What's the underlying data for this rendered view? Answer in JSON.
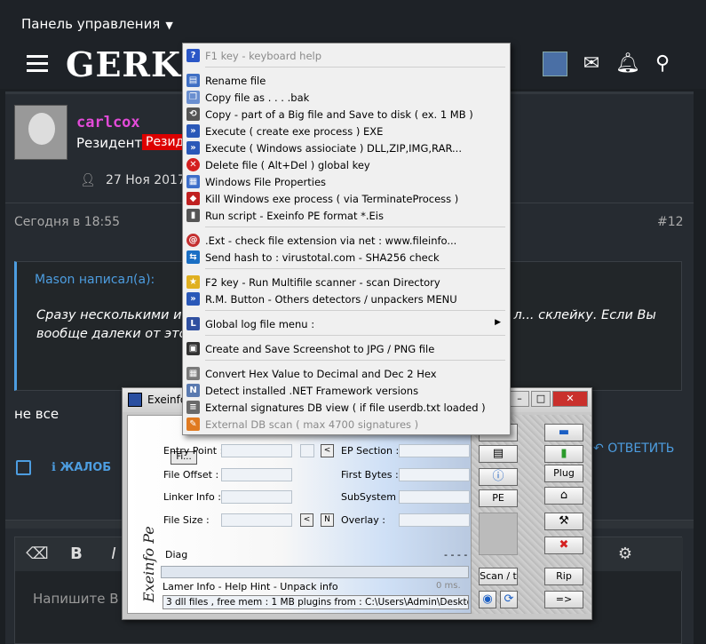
{
  "forum": {
    "control_panel": "Панель управления",
    "logo": "GERKI.R",
    "username": "carlcox",
    "role": "Резидент",
    "badge": "Резид",
    "joined": "27 Ноя 2017",
    "post_date": "Сегодня в 18:55",
    "post_number": "#12",
    "quote_author": "Mason написал(а):",
    "quote_text": "Сразу несколькими ин... была мысль запостить всё это дело, но есть л... склейку. Если Вы вообще далеки от это... песочьте в чем сомнения есть, там ви...",
    "reply_text": "не все",
    "complain": "ЖАЛОБ",
    "reply_button": "ОТВЕТИТЬ",
    "editor_placeholder": "Напишите В",
    "editor_tools": [
      "⌫",
      "B",
      "I",
      "⚙"
    ]
  },
  "exeinfo": {
    "title": "Exeinfo",
    "side_label": "Exeinfo Pe",
    "file_button": "Fi...",
    "fields": {
      "entry_point": "Entry Point :",
      "ep_section": "EP Section :",
      "file_offset": "File Offset :",
      "first_bytes": "First Bytes :",
      "linker_info": "Linker Info :",
      "subsystem": "SubSystem :",
      "file_size": "File Size :",
      "overlay": "Overlay :",
      "diag": "Diag"
    },
    "small_lt": "<",
    "small_n": "N",
    "dashes": "- - - -",
    "hint": "Lamer Info - Help Hint - Unpack info",
    "ms": "0 ms.",
    "status": "3 dll files , free mem : 1 MB  plugins from : C:\\Users\\Admin\\Desktop\\Ск...",
    "buttons": {
      "plug": "Plug",
      "pe": "PE",
      "scan": "Scan / t",
      "rip": "Rip",
      "next": "=>"
    }
  },
  "menu": {
    "items": [
      {
        "label": "F1 key - keyboard help",
        "icon": "help-icon",
        "color": "#2b57c7",
        "glyph": "?",
        "disabled": true
      },
      {
        "label": "Rename file",
        "icon": "rename-icon",
        "color": "#3f6fc4",
        "glyph": "▤"
      },
      {
        "label": "Copy file as   . . . .bak",
        "icon": "copy-icon",
        "color": "#6a8fd0",
        "glyph": "❐"
      },
      {
        "label": "Copy - part of a Big file and Save  to disk ( ex. 1 MB )",
        "icon": "copy-part-icon",
        "color": "#555555",
        "glyph": "⟲"
      },
      {
        "label": "Execute ( create exe process ) EXE",
        "icon": "execute-icon",
        "color": "#2a58b8",
        "glyph": "»"
      },
      {
        "label": "Execute ( Windows assiociate ) DLL,ZIP,IMG,RAR...",
        "icon": "execute-assoc-icon",
        "color": "#2a58b8",
        "glyph": "»"
      },
      {
        "label": "Delete file ( Alt+Del  ) global key",
        "icon": "delete-icon",
        "color": "#d42020",
        "glyph": "✕"
      },
      {
        "label": "Windows File Properties",
        "icon": "properties-icon",
        "color": "#3d6ec9",
        "glyph": "▦"
      },
      {
        "label": "Kill Windows exe process ( via TerminateProcess )",
        "icon": "kill-icon",
        "color": "#c02020",
        "glyph": "◆"
      },
      {
        "label": "Run script - Exeinfo PE  format *.Eis",
        "icon": "script-icon",
        "color": "#555555",
        "glyph": "▮"
      },
      {
        "label": ".Ext - check file extension via net : www.fileinfo...",
        "icon": "ext-icon",
        "color": "#c43030",
        "glyph": "@"
      },
      {
        "label": "Send hash to : virustotal.com - SHA256 check",
        "icon": "virustotal-icon",
        "color": "#1a6fc4",
        "glyph": "⇆"
      },
      {
        "label": "F2 key - Run Multifile scanner  - scan Directory",
        "icon": "scanner-icon",
        "color": "#e0b020",
        "glyph": "★"
      },
      {
        "label": "R.M. Button - Others detectors / unpackers  MENU",
        "icon": "detectors-icon",
        "color": "#2a58b8",
        "glyph": "»"
      },
      {
        "label": "Global log file menu :",
        "icon": "log-icon",
        "color": "#3050a0",
        "glyph": "L",
        "submenu": true
      },
      {
        "label": "Create and Save Screenshot to JPG / PNG  file",
        "icon": "screenshot-icon",
        "color": "#333333",
        "glyph": "▣"
      },
      {
        "label": "Convert Hex Value to Decimal and Dec 2 Hex",
        "icon": "convert-icon",
        "color": "#7a7a7a",
        "glyph": "▦"
      },
      {
        "label": "Detect installed .NET Framework versions",
        "icon": "dotnet-icon",
        "color": "#5a7ab0",
        "glyph": "N"
      },
      {
        "label": "External signatures DB view  (  if file userdb.txt loaded  )",
        "icon": "signatures-icon",
        "color": "#6a6a6a",
        "glyph": "≡"
      },
      {
        "label": "External DB scan  ( max 4700 signatures )",
        "icon": "db-scan-icon",
        "color": "#e07a20",
        "glyph": "✎",
        "disabled": true
      }
    ]
  }
}
